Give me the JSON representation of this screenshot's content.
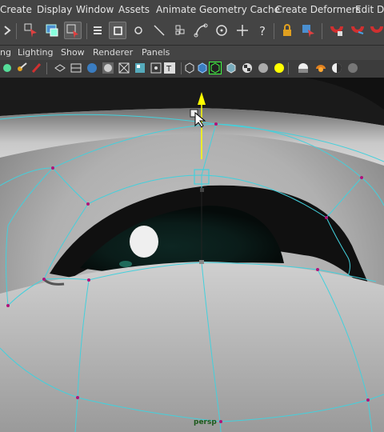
{
  "menu": {
    "items": [
      "Create",
      "Display",
      "Window",
      "Assets",
      "Animate",
      "Geometry Cache",
      "Create Deformers",
      "Edit Def"
    ]
  },
  "panel_menu": {
    "items": [
      "ng",
      "Lighting",
      "Show",
      "Renderer",
      "Panels"
    ]
  },
  "viewport": {
    "camera_label": "persp"
  },
  "colors": {
    "wire": "#43d0dc",
    "vertex": "#b0137a",
    "manip_y": "#ffff00",
    "iris": "#0c1f1c",
    "highlight": "#f2f2f2"
  },
  "icons": {
    "shelf": [
      "move-arrow-icon",
      "select-tool-icon",
      "lasso-tool-icon",
      "paint-select-icon",
      "align-icon",
      "select-box-icon",
      "sphere-icon",
      "line-tool-icon",
      "lattice-icon",
      "curve-tool-icon",
      "target-icon",
      "plus-icon",
      "help-icon",
      "lock-icon",
      "snap-select-icon",
      "magnet-red-icon",
      "magnet-blue-icon",
      "magnet-green-icon"
    ],
    "view": [
      "lasso-icon",
      "paint-icon",
      "brush-icon",
      "shading-icon",
      "wireframe-icon",
      "smooth-shade-icon",
      "flat-shade-icon",
      "xray-icon",
      "texture-icon",
      "isolate-icon",
      "text-icon",
      "cube-wire-icon",
      "cube-solid-icon",
      "frame-select-icon",
      "cube-outline-icon",
      "checker-icon",
      "sphere-grey-icon",
      "light-yellow-icon",
      "light-grey-icon",
      "light-orange-icon",
      "half-sphere-icon",
      "sphere-shaded-icon"
    ]
  }
}
